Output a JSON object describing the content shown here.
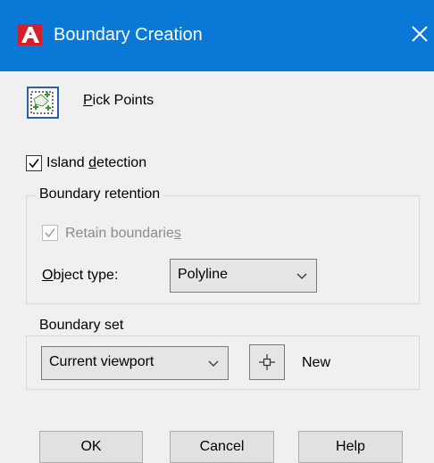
{
  "window": {
    "title": "Boundary Creation",
    "close_glyph": "✕"
  },
  "pick_points": {
    "label_first": "P",
    "label_rest": "ick Points",
    "icon": "pick-points-icon"
  },
  "island_detection": {
    "checked": true,
    "label_pre": "Island ",
    "label_accel": "d",
    "label_post": "etection"
  },
  "boundary_retention": {
    "title": "Boundary retention",
    "retain": {
      "checked": true,
      "disabled": true,
      "label_pre": "Retain boundarie",
      "label_accel": "s"
    },
    "object_type": {
      "label_accel": "O",
      "label_rest": "bject type:",
      "value": "Polyline"
    }
  },
  "boundary_set": {
    "title": "Boundary set",
    "selection": "Current viewport",
    "new_label": "New",
    "crosshair_icon": "crosshair-icon"
  },
  "buttons": {
    "ok": "OK",
    "cancel": "Cancel",
    "help": "Help"
  },
  "colors": {
    "titlebar": "#0a78d7",
    "background": "#f0f0f0",
    "logo_red": "#d5202b"
  }
}
